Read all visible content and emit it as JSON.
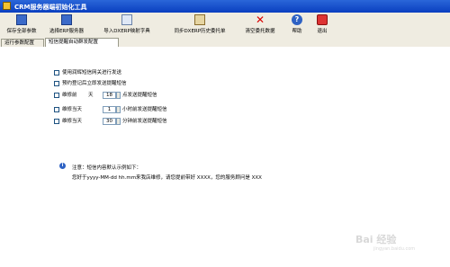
{
  "window": {
    "title": "CRM服务器端初始化工具"
  },
  "toolbar": {
    "buttons": [
      {
        "label": "保存全部参数",
        "icon": "save-all-icon"
      },
      {
        "label": "选择ERP服务器",
        "icon": "server-select-icon"
      },
      {
        "label": "导入DXERP映射字典",
        "icon": "import-dictionary-icon"
      },
      {
        "label": "同步DXERP历史委托单",
        "icon": "sync-orders-icon"
      },
      {
        "label": "清空委托数据",
        "icon": "clear-data-icon"
      },
      {
        "label": "帮助",
        "icon": "help-icon"
      },
      {
        "label": "退出",
        "icon": "exit-icon"
      }
    ]
  },
  "tabs": [
    {
      "label": "运行参数配置",
      "active": false
    },
    {
      "label": "短信提醒自动群发配置",
      "active": true
    }
  ],
  "options": {
    "use_sms_gateway": "使用润辉短信网关进行发送",
    "send_after_register": "预约登记后立即发送提醒短信",
    "days_before": {
      "prefix": "维修前",
      "unit": "天",
      "value": "18",
      "suffix": "点发送提醒短信"
    },
    "same_day_hours": {
      "prefix": "维修当天",
      "value": "1",
      "suffix": "小时前发送提醒短信"
    },
    "same_day_minutes": {
      "prefix": "维修当天",
      "value": "30",
      "suffix": "分钟前发送提醒短信"
    }
  },
  "note": {
    "title": "注意：短信内容默认示例如下：",
    "body": "您好于yyyy-MM-dd hh.mm来我店维修，请您提前带好 XXXX，您的服务顾问是 XXX"
  },
  "watermark": {
    "main": "Bai 经验",
    "sub": "jingyan.baidu.com"
  },
  "colors": {
    "titlebar": "#0a3fbf",
    "toolbar_bg": "#efece1",
    "accent": "#2e62c4"
  }
}
